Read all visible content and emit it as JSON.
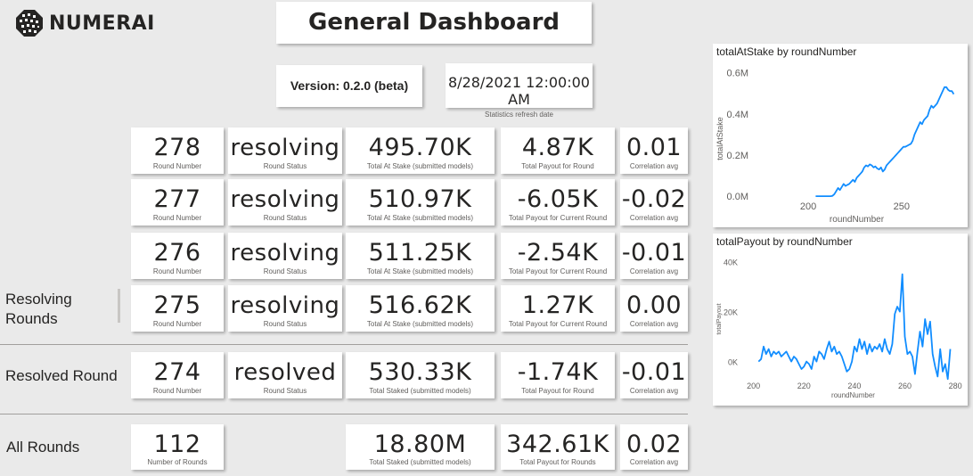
{
  "brand": {
    "name": "NUMERAI"
  },
  "header": {
    "title": "General Dashboard"
  },
  "version": {
    "label": "Version: 0.2.0 (beta)"
  },
  "refresh": {
    "date": "8/28/2021 12:00:00 AM",
    "caption": "Statistics refresh date"
  },
  "sections": {
    "resolving": "Resolving Rounds",
    "resolved": "Resolved Round",
    "all": "All Rounds"
  },
  "rows": [
    {
      "round": "278",
      "round_cap": "Round Number",
      "status": "resolving",
      "status_cap": "Round Status",
      "stake": "495.70K",
      "stake_cap": "Total At Stake (submitted models)",
      "payout": "4.87K",
      "payout_cap": "Total Payout for Round",
      "corr": "0.01",
      "corr_cap": "Correlation avg"
    },
    {
      "round": "277",
      "round_cap": "Round Number",
      "status": "resolving",
      "status_cap": "Round Status",
      "stake": "510.97K",
      "stake_cap": "Total At Stake (submitted models)",
      "payout": "-6.05K",
      "payout_cap": "Total Payout for Current Round",
      "corr": "-0.02",
      "corr_cap": "Correlation avg"
    },
    {
      "round": "276",
      "round_cap": "Round Number",
      "status": "resolving",
      "status_cap": "Round Status",
      "stake": "511.25K",
      "stake_cap": "Total At Stake (submitted models)",
      "payout": "-2.54K",
      "payout_cap": "Total Payout for Current Round",
      "corr": "-0.01",
      "corr_cap": "Correlation avg"
    },
    {
      "round": "275",
      "round_cap": "Round Number",
      "status": "resolving",
      "status_cap": "Round Status",
      "stake": "516.62K",
      "stake_cap": "Total At Stake (submitted models)",
      "payout": "1.27K",
      "payout_cap": "Total Payout for Current Round",
      "corr": "0.00",
      "corr_cap": "Correlation avg"
    },
    {
      "round": "274",
      "round_cap": "Round Number",
      "status": "resolved",
      "status_cap": "Round Status",
      "stake": "530.33K",
      "stake_cap": "Total Staked (submitted models)",
      "payout": "-1.74K",
      "payout_cap": "Total Payout for Round",
      "corr": "-0.01",
      "corr_cap": "Correlation avg"
    }
  ],
  "all_rounds": {
    "count": "112",
    "count_cap": "Number of Rounds",
    "staked": "18.80M",
    "staked_cap": "Total Staked (submitted models)",
    "payout": "342.61K",
    "payout_cap": "Total Payout for Rounds",
    "corr": "0.02",
    "corr_cap": "Correlation avg"
  },
  "colors": {
    "line": "#118dff",
    "background": "#eaeaea",
    "card": "#ffffff"
  },
  "chart_data": [
    {
      "type": "line",
      "title": "totalAtStake by roundNumber",
      "xlabel": "roundNumber",
      "ylabel": "totalAtStake",
      "xlim": [
        168,
        284
      ],
      "ylim": [
        -0.06,
        0.62
      ],
      "yticks": [
        0,
        0.2,
        0.4,
        0.6
      ],
      "ytick_labels": [
        "0.0M",
        "0.2M",
        "0.4M",
        "0.6M"
      ],
      "xticks": [
        200,
        250
      ],
      "xtick_labels": [
        "200",
        "250"
      ],
      "grid": false,
      "series": [
        {
          "x": [
            204,
            205,
            206,
            207,
            208,
            209,
            210,
            211,
            212,
            213,
            214,
            215,
            216,
            217,
            218,
            219,
            220,
            221,
            222,
            223,
            224,
            225,
            226,
            227,
            228,
            229,
            230,
            231,
            232,
            233,
            234,
            235,
            236,
            237,
            238,
            239,
            240,
            241,
            242,
            243,
            244,
            245,
            246,
            247,
            248,
            249,
            250,
            251,
            252,
            253,
            254,
            255,
            256,
            257,
            258,
            259,
            260,
            261,
            262,
            263,
            264,
            265,
            266,
            267,
            268,
            269,
            270,
            271,
            272,
            273,
            274,
            275,
            276,
            277,
            278
          ],
          "values": [
            0.0,
            0.0,
            0.0,
            0.0,
            0.0,
            0.0,
            0.0,
            0.0,
            0.0,
            0.002,
            0.01,
            0.025,
            0.04,
            0.03,
            0.045,
            0.06,
            0.05,
            0.055,
            0.06,
            0.07,
            0.08,
            0.07,
            0.09,
            0.1,
            0.11,
            0.12,
            0.14,
            0.15,
            0.145,
            0.155,
            0.15,
            0.14,
            0.145,
            0.135,
            0.13,
            0.14,
            0.12,
            0.13,
            0.15,
            0.16,
            0.17,
            0.18,
            0.19,
            0.2,
            0.21,
            0.22,
            0.23,
            0.24,
            0.24,
            0.245,
            0.25,
            0.255,
            0.27,
            0.3,
            0.32,
            0.34,
            0.36,
            0.35,
            0.37,
            0.38,
            0.39,
            0.42,
            0.44,
            0.43,
            0.44,
            0.45,
            0.47,
            0.49,
            0.51,
            0.53,
            0.53,
            0.517,
            0.511,
            0.511,
            0.496
          ]
        }
      ]
    },
    {
      "type": "line",
      "title": "totalPayout by roundNumber",
      "xlabel": "roundNumber",
      "ylabel": "totalPayout",
      "xlim": [
        198,
        281
      ],
      "ylim": [
        -8,
        42
      ],
      "yticks": [
        0,
        20,
        40
      ],
      "ytick_labels": [
        "0K",
        "20K",
        "40K"
      ],
      "xticks": [
        200,
        220,
        240,
        260,
        280
      ],
      "xtick_labels": [
        "200",
        "220",
        "240",
        "260",
        "280"
      ],
      "grid": false,
      "series": [
        {
          "x": [
            202,
            203,
            204,
            205,
            206,
            207,
            208,
            209,
            210,
            211,
            212,
            213,
            214,
            215,
            216,
            217,
            218,
            219,
            220,
            221,
            222,
            223,
            224,
            225,
            226,
            227,
            228,
            229,
            230,
            231,
            232,
            233,
            234,
            235,
            236,
            237,
            238,
            239,
            240,
            241,
            242,
            243,
            244,
            245,
            246,
            247,
            248,
            249,
            250,
            251,
            252,
            253,
            254,
            255,
            256,
            257,
            258,
            259,
            260,
            261,
            262,
            263,
            264,
            265,
            266,
            267,
            268,
            269,
            270,
            271,
            272,
            273,
            274,
            275,
            276,
            277,
            278
          ],
          "values": [
            0,
            1,
            6,
            3,
            5,
            2,
            4,
            3,
            4,
            2,
            3,
            4,
            2,
            0,
            2,
            1,
            -1,
            -3,
            -2,
            0,
            -1,
            -3,
            2,
            0,
            4,
            3,
            1,
            5,
            8,
            4,
            6,
            3,
            4,
            2,
            -1,
            -4,
            -3,
            0,
            6,
            4,
            9,
            5,
            8,
            3,
            7,
            4,
            6,
            5,
            7,
            4,
            9,
            5,
            3,
            7,
            19,
            22,
            20,
            35,
            10,
            3,
            4,
            2,
            -5,
            4,
            12,
            6,
            17,
            11,
            16,
            3,
            -2,
            -6,
            5,
            -4,
            -1,
            -7,
            5
          ]
        }
      ]
    }
  ]
}
